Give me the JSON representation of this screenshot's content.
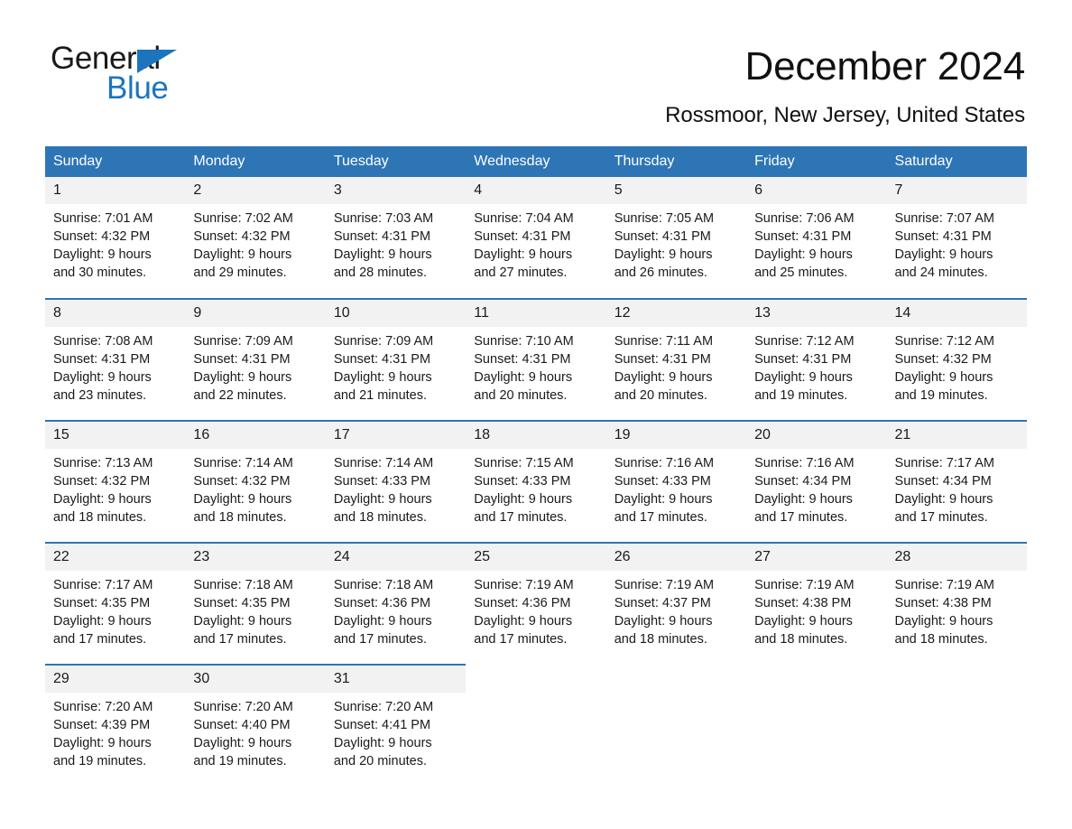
{
  "brand": {
    "name_part1": "General",
    "name_part2": "Blue",
    "accent_color": "#1c75bc"
  },
  "header": {
    "title": "December 2024",
    "subtitle": "Rossmoor, New Jersey, United States"
  },
  "theme": {
    "header_blue": "#2e75b6",
    "daynum_gray": "#f2f2f2"
  },
  "calendar": {
    "weekdays": [
      "Sunday",
      "Monday",
      "Tuesday",
      "Wednesday",
      "Thursday",
      "Friday",
      "Saturday"
    ],
    "weeks": [
      [
        {
          "day": "1",
          "sunrise": "Sunrise: 7:01 AM",
          "sunset": "Sunset: 4:32 PM",
          "daylight_line1": "Daylight: 9 hours",
          "daylight_line2": "and 30 minutes."
        },
        {
          "day": "2",
          "sunrise": "Sunrise: 7:02 AM",
          "sunset": "Sunset: 4:32 PM",
          "daylight_line1": "Daylight: 9 hours",
          "daylight_line2": "and 29 minutes."
        },
        {
          "day": "3",
          "sunrise": "Sunrise: 7:03 AM",
          "sunset": "Sunset: 4:31 PM",
          "daylight_line1": "Daylight: 9 hours",
          "daylight_line2": "and 28 minutes."
        },
        {
          "day": "4",
          "sunrise": "Sunrise: 7:04 AM",
          "sunset": "Sunset: 4:31 PM",
          "daylight_line1": "Daylight: 9 hours",
          "daylight_line2": "and 27 minutes."
        },
        {
          "day": "5",
          "sunrise": "Sunrise: 7:05 AM",
          "sunset": "Sunset: 4:31 PM",
          "daylight_line1": "Daylight: 9 hours",
          "daylight_line2": "and 26 minutes."
        },
        {
          "day": "6",
          "sunrise": "Sunrise: 7:06 AM",
          "sunset": "Sunset: 4:31 PM",
          "daylight_line1": "Daylight: 9 hours",
          "daylight_line2": "and 25 minutes."
        },
        {
          "day": "7",
          "sunrise": "Sunrise: 7:07 AM",
          "sunset": "Sunset: 4:31 PM",
          "daylight_line1": "Daylight: 9 hours",
          "daylight_line2": "and 24 minutes."
        }
      ],
      [
        {
          "day": "8",
          "sunrise": "Sunrise: 7:08 AM",
          "sunset": "Sunset: 4:31 PM",
          "daylight_line1": "Daylight: 9 hours",
          "daylight_line2": "and 23 minutes."
        },
        {
          "day": "9",
          "sunrise": "Sunrise: 7:09 AM",
          "sunset": "Sunset: 4:31 PM",
          "daylight_line1": "Daylight: 9 hours",
          "daylight_line2": "and 22 minutes."
        },
        {
          "day": "10",
          "sunrise": "Sunrise: 7:09 AM",
          "sunset": "Sunset: 4:31 PM",
          "daylight_line1": "Daylight: 9 hours",
          "daylight_line2": "and 21 minutes."
        },
        {
          "day": "11",
          "sunrise": "Sunrise: 7:10 AM",
          "sunset": "Sunset: 4:31 PM",
          "daylight_line1": "Daylight: 9 hours",
          "daylight_line2": "and 20 minutes."
        },
        {
          "day": "12",
          "sunrise": "Sunrise: 7:11 AM",
          "sunset": "Sunset: 4:31 PM",
          "daylight_line1": "Daylight: 9 hours",
          "daylight_line2": "and 20 minutes."
        },
        {
          "day": "13",
          "sunrise": "Sunrise: 7:12 AM",
          "sunset": "Sunset: 4:31 PM",
          "daylight_line1": "Daylight: 9 hours",
          "daylight_line2": "and 19 minutes."
        },
        {
          "day": "14",
          "sunrise": "Sunrise: 7:12 AM",
          "sunset": "Sunset: 4:32 PM",
          "daylight_line1": "Daylight: 9 hours",
          "daylight_line2": "and 19 minutes."
        }
      ],
      [
        {
          "day": "15",
          "sunrise": "Sunrise: 7:13 AM",
          "sunset": "Sunset: 4:32 PM",
          "daylight_line1": "Daylight: 9 hours",
          "daylight_line2": "and 18 minutes."
        },
        {
          "day": "16",
          "sunrise": "Sunrise: 7:14 AM",
          "sunset": "Sunset: 4:32 PM",
          "daylight_line1": "Daylight: 9 hours",
          "daylight_line2": "and 18 minutes."
        },
        {
          "day": "17",
          "sunrise": "Sunrise: 7:14 AM",
          "sunset": "Sunset: 4:33 PM",
          "daylight_line1": "Daylight: 9 hours",
          "daylight_line2": "and 18 minutes."
        },
        {
          "day": "18",
          "sunrise": "Sunrise: 7:15 AM",
          "sunset": "Sunset: 4:33 PM",
          "daylight_line1": "Daylight: 9 hours",
          "daylight_line2": "and 17 minutes."
        },
        {
          "day": "19",
          "sunrise": "Sunrise: 7:16 AM",
          "sunset": "Sunset: 4:33 PM",
          "daylight_line1": "Daylight: 9 hours",
          "daylight_line2": "and 17 minutes."
        },
        {
          "day": "20",
          "sunrise": "Sunrise: 7:16 AM",
          "sunset": "Sunset: 4:34 PM",
          "daylight_line1": "Daylight: 9 hours",
          "daylight_line2": "and 17 minutes."
        },
        {
          "day": "21",
          "sunrise": "Sunrise: 7:17 AM",
          "sunset": "Sunset: 4:34 PM",
          "daylight_line1": "Daylight: 9 hours",
          "daylight_line2": "and 17 minutes."
        }
      ],
      [
        {
          "day": "22",
          "sunrise": "Sunrise: 7:17 AM",
          "sunset": "Sunset: 4:35 PM",
          "daylight_line1": "Daylight: 9 hours",
          "daylight_line2": "and 17 minutes."
        },
        {
          "day": "23",
          "sunrise": "Sunrise: 7:18 AM",
          "sunset": "Sunset: 4:35 PM",
          "daylight_line1": "Daylight: 9 hours",
          "daylight_line2": "and 17 minutes."
        },
        {
          "day": "24",
          "sunrise": "Sunrise: 7:18 AM",
          "sunset": "Sunset: 4:36 PM",
          "daylight_line1": "Daylight: 9 hours",
          "daylight_line2": "and 17 minutes."
        },
        {
          "day": "25",
          "sunrise": "Sunrise: 7:19 AM",
          "sunset": "Sunset: 4:36 PM",
          "daylight_line1": "Daylight: 9 hours",
          "daylight_line2": "and 17 minutes."
        },
        {
          "day": "26",
          "sunrise": "Sunrise: 7:19 AM",
          "sunset": "Sunset: 4:37 PM",
          "daylight_line1": "Daylight: 9 hours",
          "daylight_line2": "and 18 minutes."
        },
        {
          "day": "27",
          "sunrise": "Sunrise: 7:19 AM",
          "sunset": "Sunset: 4:38 PM",
          "daylight_line1": "Daylight: 9 hours",
          "daylight_line2": "and 18 minutes."
        },
        {
          "day": "28",
          "sunrise": "Sunrise: 7:19 AM",
          "sunset": "Sunset: 4:38 PM",
          "daylight_line1": "Daylight: 9 hours",
          "daylight_line2": "and 18 minutes."
        }
      ],
      [
        {
          "day": "29",
          "sunrise": "Sunrise: 7:20 AM",
          "sunset": "Sunset: 4:39 PM",
          "daylight_line1": "Daylight: 9 hours",
          "daylight_line2": "and 19 minutes."
        },
        {
          "day": "30",
          "sunrise": "Sunrise: 7:20 AM",
          "sunset": "Sunset: 4:40 PM",
          "daylight_line1": "Daylight: 9 hours",
          "daylight_line2": "and 19 minutes."
        },
        {
          "day": "31",
          "sunrise": "Sunrise: 7:20 AM",
          "sunset": "Sunset: 4:41 PM",
          "daylight_line1": "Daylight: 9 hours",
          "daylight_line2": "and 20 minutes."
        },
        {
          "day": "",
          "sunrise": "",
          "sunset": "",
          "daylight_line1": "",
          "daylight_line2": ""
        },
        {
          "day": "",
          "sunrise": "",
          "sunset": "",
          "daylight_line1": "",
          "daylight_line2": ""
        },
        {
          "day": "",
          "sunrise": "",
          "sunset": "",
          "daylight_line1": "",
          "daylight_line2": ""
        },
        {
          "day": "",
          "sunrise": "",
          "sunset": "",
          "daylight_line1": "",
          "daylight_line2": ""
        }
      ]
    ]
  }
}
